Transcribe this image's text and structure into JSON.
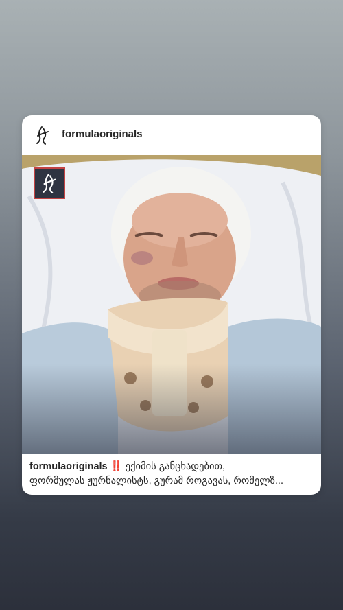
{
  "post": {
    "username": "formulaoriginals",
    "caption_user": "formulaoriginals",
    "caption_emoji": "‼️",
    "caption_line1": " ექიმის განცხადებით,",
    "caption_line2": "ფორმულას ჟურნალისტს, გურამ როგავას, რომელზ..."
  },
  "icons": {
    "avatar": "formula-logo-icon",
    "photo_watermark": "formula-watermark-icon"
  },
  "colors": {
    "card_bg": "#ffffff",
    "text": "#262626",
    "emoji_red": "#e0245e"
  }
}
